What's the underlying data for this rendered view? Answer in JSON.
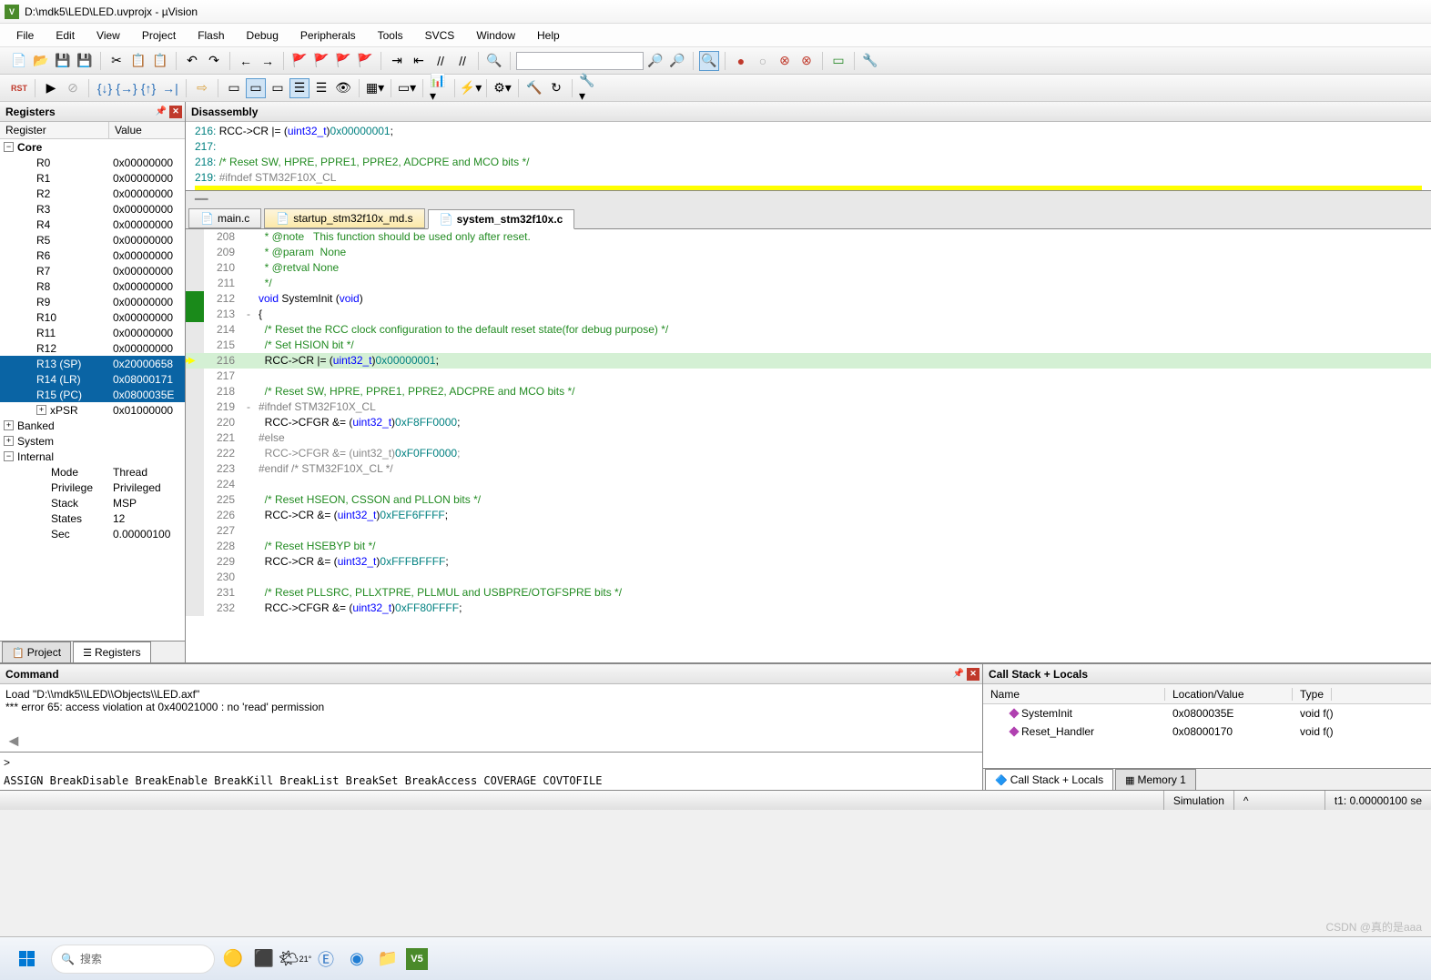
{
  "title": "D:\\mdk5\\LED\\LED.uvprojx - µVision",
  "menu": [
    "File",
    "Edit",
    "View",
    "Project",
    "Flash",
    "Debug",
    "Peripherals",
    "Tools",
    "SVCS",
    "Window",
    "Help"
  ],
  "panels": {
    "registers": "Registers",
    "disassembly": "Disassembly",
    "command": "Command",
    "callstack": "Call Stack + Locals"
  },
  "reg_header": {
    "c1": "Register",
    "c2": "Value"
  },
  "registers": {
    "core_label": "Core",
    "items": [
      {
        "n": "R0",
        "v": "0x00000000"
      },
      {
        "n": "R1",
        "v": "0x00000000"
      },
      {
        "n": "R2",
        "v": "0x00000000"
      },
      {
        "n": "R3",
        "v": "0x00000000"
      },
      {
        "n": "R4",
        "v": "0x00000000"
      },
      {
        "n": "R5",
        "v": "0x00000000"
      },
      {
        "n": "R6",
        "v": "0x00000000"
      },
      {
        "n": "R7",
        "v": "0x00000000"
      },
      {
        "n": "R8",
        "v": "0x00000000"
      },
      {
        "n": "R9",
        "v": "0x00000000"
      },
      {
        "n": "R10",
        "v": "0x00000000"
      },
      {
        "n": "R11",
        "v": "0x00000000"
      },
      {
        "n": "R12",
        "v": "0x00000000"
      },
      {
        "n": "R13 (SP)",
        "v": "0x20000658",
        "sel": true
      },
      {
        "n": "R14 (LR)",
        "v": "0x08000171",
        "sel": true
      },
      {
        "n": "R15 (PC)",
        "v": "0x0800035E",
        "sel": true
      },
      {
        "n": "xPSR",
        "v": "0x01000000",
        "plus": true
      }
    ],
    "banked": "Banked",
    "system": "System",
    "internal": "Internal",
    "int_items": [
      {
        "n": "Mode",
        "v": "Thread"
      },
      {
        "n": "Privilege",
        "v": "Privileged"
      },
      {
        "n": "Stack",
        "v": "MSP"
      },
      {
        "n": "States",
        "v": "12"
      },
      {
        "n": "Sec",
        "v": "0.00000100"
      }
    ]
  },
  "reg_tabs": {
    "project": "Project",
    "registers": "Registers"
  },
  "disasm": [
    {
      "n": "216:",
      "t": "   RCC->CR |= (uint32_t)0x00000001;"
    },
    {
      "n": "217:",
      "t": ""
    },
    {
      "n": "218:",
      "t": "   /* Reset SW, HPRE, PPRE1, PPRE2, ADCPRE and MCO bits */"
    },
    {
      "n": "219:",
      "t": " #ifndef STM32F10X_CL"
    }
  ],
  "tabs": [
    {
      "label": "main.c",
      "icon": "c"
    },
    {
      "label": "startup_stm32f10x_md.s",
      "icon": "s"
    },
    {
      "label": "system_stm32f10x.c",
      "icon": "c",
      "active": true
    }
  ],
  "code": [
    {
      "n": 208,
      "t": "  * @note   This function should be used only after reset.",
      "cls": "c-comment"
    },
    {
      "n": 209,
      "t": "  * @param  None",
      "cls": "c-comment"
    },
    {
      "n": 210,
      "t": "  * @retval None",
      "cls": "c-comment"
    },
    {
      "n": 211,
      "t": "  */",
      "cls": "c-comment"
    },
    {
      "n": 212,
      "t": "void SystemInit (void)",
      "cls": "c-keyword",
      "m": "green"
    },
    {
      "n": 213,
      "t": "{",
      "fold": "-",
      "m": "green"
    },
    {
      "n": 214,
      "t": "  /* Reset the RCC clock configuration to the default reset state(for debug purpose) */",
      "cls": "c-comment"
    },
    {
      "n": 215,
      "t": "  /* Set HSION bit */",
      "cls": "c-comment"
    },
    {
      "n": 216,
      "t": "  RCC->CR |= (uint32_t)0x00000001;",
      "hl": true,
      "m": "arrow"
    },
    {
      "n": 217,
      "t": ""
    },
    {
      "n": 218,
      "t": "  /* Reset SW, HPRE, PPRE1, PPRE2, ADCPRE and MCO bits */",
      "cls": "c-comment"
    },
    {
      "n": 219,
      "t": "#ifndef STM32F10X_CL",
      "cls": "c-pp",
      "fold": "-"
    },
    {
      "n": 220,
      "t": "  RCC->CFGR &= (uint32_t)0xF8FF0000;"
    },
    {
      "n": 221,
      "t": "#else",
      "cls": "c-pp"
    },
    {
      "n": 222,
      "t": "  RCC->CFGR &= (uint32_t)0xF0FF0000;",
      "dim": true
    },
    {
      "n": 223,
      "t": "#endif /* STM32F10X_CL */",
      "cls": "c-pp"
    },
    {
      "n": 224,
      "t": ""
    },
    {
      "n": 225,
      "t": "  /* Reset HSEON, CSSON and PLLON bits */",
      "cls": "c-comment"
    },
    {
      "n": 226,
      "t": "  RCC->CR &= (uint32_t)0xFEF6FFFF;"
    },
    {
      "n": 227,
      "t": ""
    },
    {
      "n": 228,
      "t": "  /* Reset HSEBYP bit */",
      "cls": "c-comment"
    },
    {
      "n": 229,
      "t": "  RCC->CR &= (uint32_t)0xFFFBFFFF;"
    },
    {
      "n": 230,
      "t": ""
    },
    {
      "n": 231,
      "t": "  /* Reset PLLSRC, PLLXTPRE, PLLMUL and USBPRE/OTGFSPRE bits */",
      "cls": "c-comment"
    },
    {
      "n": 232,
      "t": "  RCC->CFGR &= (uint32_t)0xFF80FFFF;"
    }
  ],
  "command": {
    "lines": [
      "Load \"D:\\\\mdk5\\\\LED\\\\Objects\\\\LED.axf\"",
      "*** error 65: access violation at 0x40021000 : no 'read' permission"
    ],
    "prompt": ">",
    "hints": "ASSIGN BreakDisable BreakEnable BreakKill BreakList BreakSet BreakAccess COVERAGE COVTOFILE"
  },
  "callstack": {
    "headers": [
      "Name",
      "Location/Value",
      "Type"
    ],
    "rows": [
      {
        "n": "SystemInit",
        "loc": "0x0800035E",
        "t": "void f()"
      },
      {
        "n": "Reset_Handler",
        "loc": "0x08000170",
        "t": "void f()"
      }
    ],
    "tabs": [
      "Call Stack + Locals",
      "Memory 1"
    ]
  },
  "status": {
    "sim": "Simulation",
    "time": "t1: 0.00000100 se"
  },
  "taskbar": {
    "search": "搜索",
    "weather": "21°"
  },
  "watermark": "CSDN @真的是aaa"
}
